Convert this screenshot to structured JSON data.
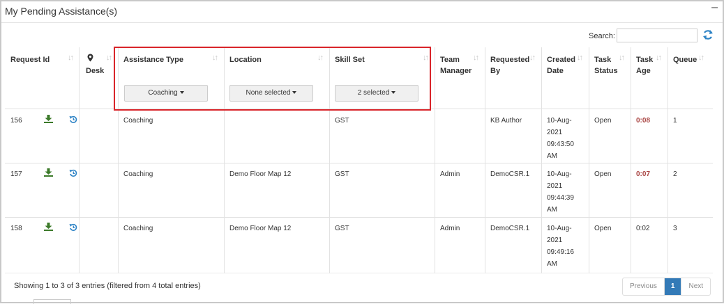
{
  "panel": {
    "title": "My Pending Assistance(s)",
    "collapse_glyph": "–"
  },
  "search": {
    "label": "Search:",
    "value": "",
    "placeholder": ""
  },
  "columns": {
    "request_id": "Request Id",
    "desk": "Desk",
    "assistance_type": "Assistance Type",
    "location": "Location",
    "skill_set": "Skill Set",
    "team_manager": "Team Manager",
    "requested_by": "Requested By",
    "created_date": "Created Date",
    "task_status": "Task Status",
    "task_age": "Task Age",
    "queue": "Queue"
  },
  "filters": {
    "assistance_type": "Coaching",
    "location": "None selected",
    "skill_set": "2 selected"
  },
  "rows": [
    {
      "id": "156",
      "assistance_type": "Coaching",
      "location": "",
      "skill_set": "GST",
      "team_manager": "",
      "requested_by": "KB Author",
      "created_1": "10-Aug-",
      "created_2": "2021",
      "created_3": "09:43:50",
      "created_4": "AM",
      "status": "Open",
      "age": "0:08",
      "queue": "1"
    },
    {
      "id": "157",
      "assistance_type": "Coaching",
      "location": "Demo Floor Map 12",
      "skill_set": "GST",
      "team_manager": "Admin",
      "requested_by": "DemoCSR.1",
      "created_1": "10-Aug-",
      "created_2": "2021",
      "created_3": "09:44:39",
      "created_4": "AM",
      "status": "Open",
      "age": "0:07",
      "queue": "2"
    },
    {
      "id": "158",
      "assistance_type": "Coaching",
      "location": "Demo Floor Map 12",
      "skill_set": "GST",
      "team_manager": "Admin",
      "requested_by": "DemoCSR.1",
      "created_1": "10-Aug-",
      "created_2": "2021",
      "created_3": "09:49:16",
      "created_4": "AM",
      "status": "Open",
      "age": "0:02",
      "queue": "3"
    }
  ],
  "footer": {
    "info": "Showing 1 to 3 of 3 entries (filtered from 4 total entries)"
  },
  "pagination": {
    "previous": "Previous",
    "current": "1",
    "next": "Next"
  },
  "colors": {
    "accent": "#337ab7",
    "highlight": "#d9252a",
    "age_warning": "#a94442",
    "download_icon": "#3c7a2a",
    "refresh_icon": "#2f84c6"
  },
  "icons": {
    "desk": "map-pin-icon",
    "download": "download-icon",
    "history": "history-icon",
    "refresh": "refresh-icon",
    "sort": "sort-icon"
  }
}
